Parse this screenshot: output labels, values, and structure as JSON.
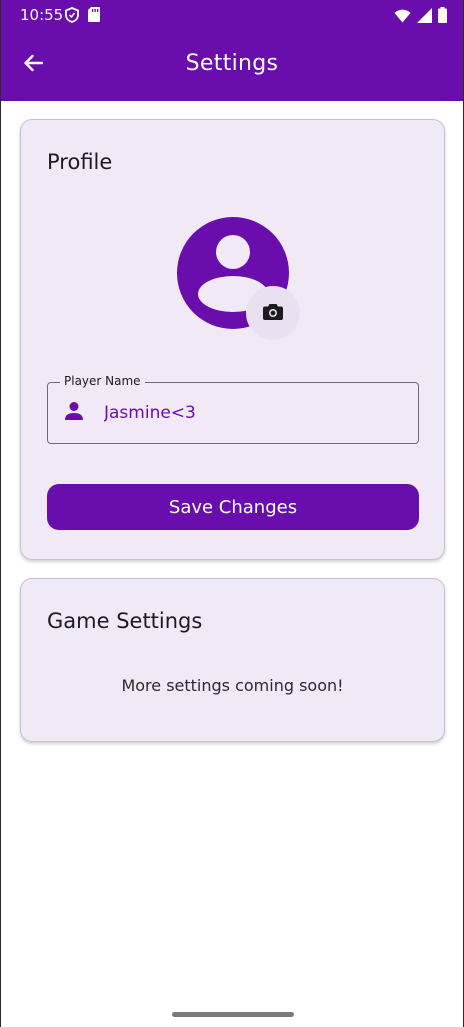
{
  "status_bar": {
    "time": "10:55",
    "left_icons": [
      "shield-icon",
      "sd-card-icon"
    ],
    "right_icons": [
      "wifi-icon",
      "signal-icon",
      "battery-icon"
    ]
  },
  "app_bar": {
    "title": "Settings",
    "back_icon": "arrow-back-icon"
  },
  "profile": {
    "title": "Profile",
    "avatar_icon": "account-circle-icon",
    "camera_icon": "camera-icon",
    "name_field": {
      "label": "Player Name",
      "value": "Jasmine<3",
      "icon": "person-icon"
    },
    "save_label": "Save Changes"
  },
  "game_settings": {
    "title": "Game Settings",
    "message": "More settings coming soon!"
  },
  "colors": {
    "primary": "#6a0dad",
    "card_bg": "#f2e9f7",
    "on_primary": "#ffffff"
  }
}
